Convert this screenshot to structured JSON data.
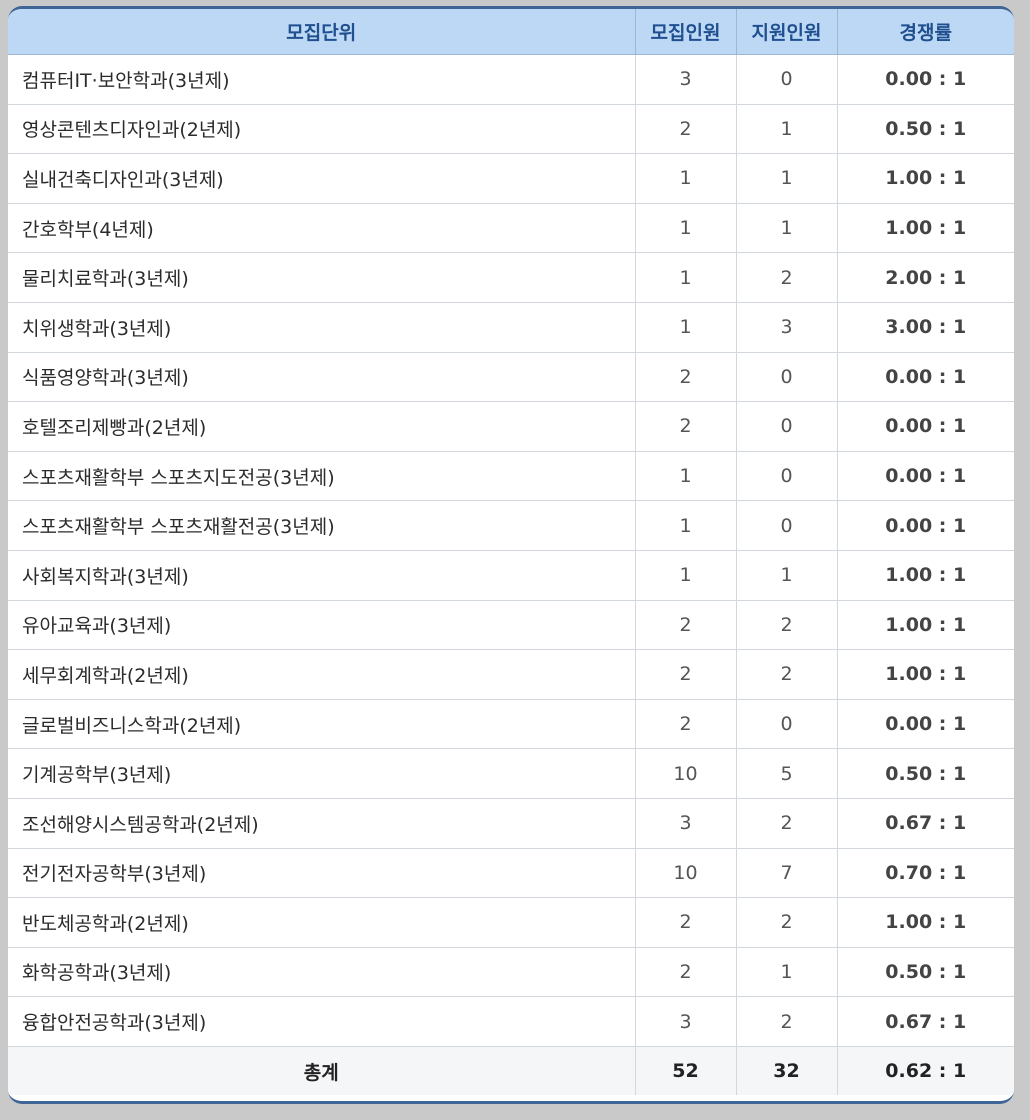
{
  "table": {
    "headers": [
      "모집단위",
      "모집인원",
      "지원인원",
      "경쟁률"
    ],
    "rows": [
      [
        "컴퓨터IT·보안학과(3년제)",
        "3",
        "0",
        "0.00 : 1"
      ],
      [
        "영상콘텐츠디자인과(2년제)",
        "2",
        "1",
        "0.50 : 1"
      ],
      [
        "실내건축디자인과(3년제)",
        "1",
        "1",
        "1.00 : 1"
      ],
      [
        "간호학부(4년제)",
        "1",
        "1",
        "1.00 : 1"
      ],
      [
        "물리치료학과(3년제)",
        "1",
        "2",
        "2.00 : 1"
      ],
      [
        "치위생학과(3년제)",
        "1",
        "3",
        "3.00 : 1"
      ],
      [
        "식품영양학과(3년제)",
        "2",
        "0",
        "0.00 : 1"
      ],
      [
        "호텔조리제빵과(2년제)",
        "2",
        "0",
        "0.00 : 1"
      ],
      [
        "스포츠재활학부 스포츠지도전공(3년제)",
        "1",
        "0",
        "0.00 : 1"
      ],
      [
        "스포츠재활학부 스포츠재활전공(3년제)",
        "1",
        "0",
        "0.00 : 1"
      ],
      [
        "사회복지학과(3년제)",
        "1",
        "1",
        "1.00 : 1"
      ],
      [
        "유아교육과(3년제)",
        "2",
        "2",
        "1.00 : 1"
      ],
      [
        "세무회계학과(2년제)",
        "2",
        "2",
        "1.00 : 1"
      ],
      [
        "글로벌비즈니스학과(2년제)",
        "2",
        "0",
        "0.00 : 1"
      ],
      [
        "기계공학부(3년제)",
        "10",
        "5",
        "0.50 : 1"
      ],
      [
        "조선해양시스템공학과(2년제)",
        "3",
        "2",
        "0.67 : 1"
      ],
      [
        "전기전자공학부(3년제)",
        "10",
        "7",
        "0.70 : 1"
      ],
      [
        "반도체공학과(2년제)",
        "2",
        "2",
        "1.00 : 1"
      ],
      [
        "화학공학과(3년제)",
        "2",
        "1",
        "0.50 : 1"
      ],
      [
        "융합안전공학과(3년제)",
        "3",
        "2",
        "0.67 : 1"
      ]
    ],
    "total": [
      "총계",
      "52",
      "32",
      "0.62 : 1"
    ]
  }
}
